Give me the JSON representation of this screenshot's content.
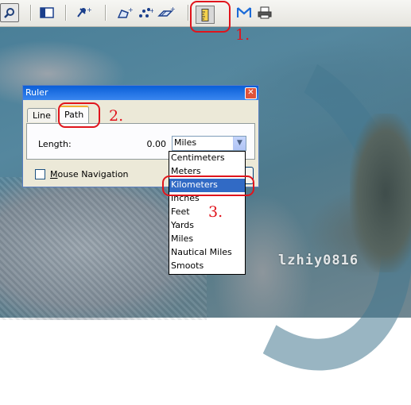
{
  "toolbar": {
    "items": [
      "search-icon",
      "sidebar-icon",
      "placemark-icon",
      "polygon-icon",
      "path-icon",
      "overlay-icon",
      "ruler-icon",
      "email-icon",
      "print-icon"
    ]
  },
  "dialog": {
    "title": "Ruler",
    "close_glyph": "✕",
    "tabs": [
      "Line",
      "Path"
    ],
    "active_tab": "Path",
    "length_label": "Length:",
    "length_value": "0.00",
    "unit_selected": "Miles",
    "mouse_nav_label": "Mouse Navigation",
    "mouse_nav_checked": false
  },
  "dropdown": {
    "options": [
      "Centimeters",
      "Meters",
      "Kilometers",
      "Inches",
      "Feet",
      "Yards",
      "Miles",
      "Nautical Miles",
      "Smoots"
    ],
    "highlighted": "Kilometers"
  },
  "annotations": [
    "1.",
    "2.",
    "3."
  ],
  "watermark": "lzhiy0816",
  "colors": {
    "annotation": "#e0141c",
    "title_bar": "#0a5fd8",
    "selection": "#316ac5"
  }
}
